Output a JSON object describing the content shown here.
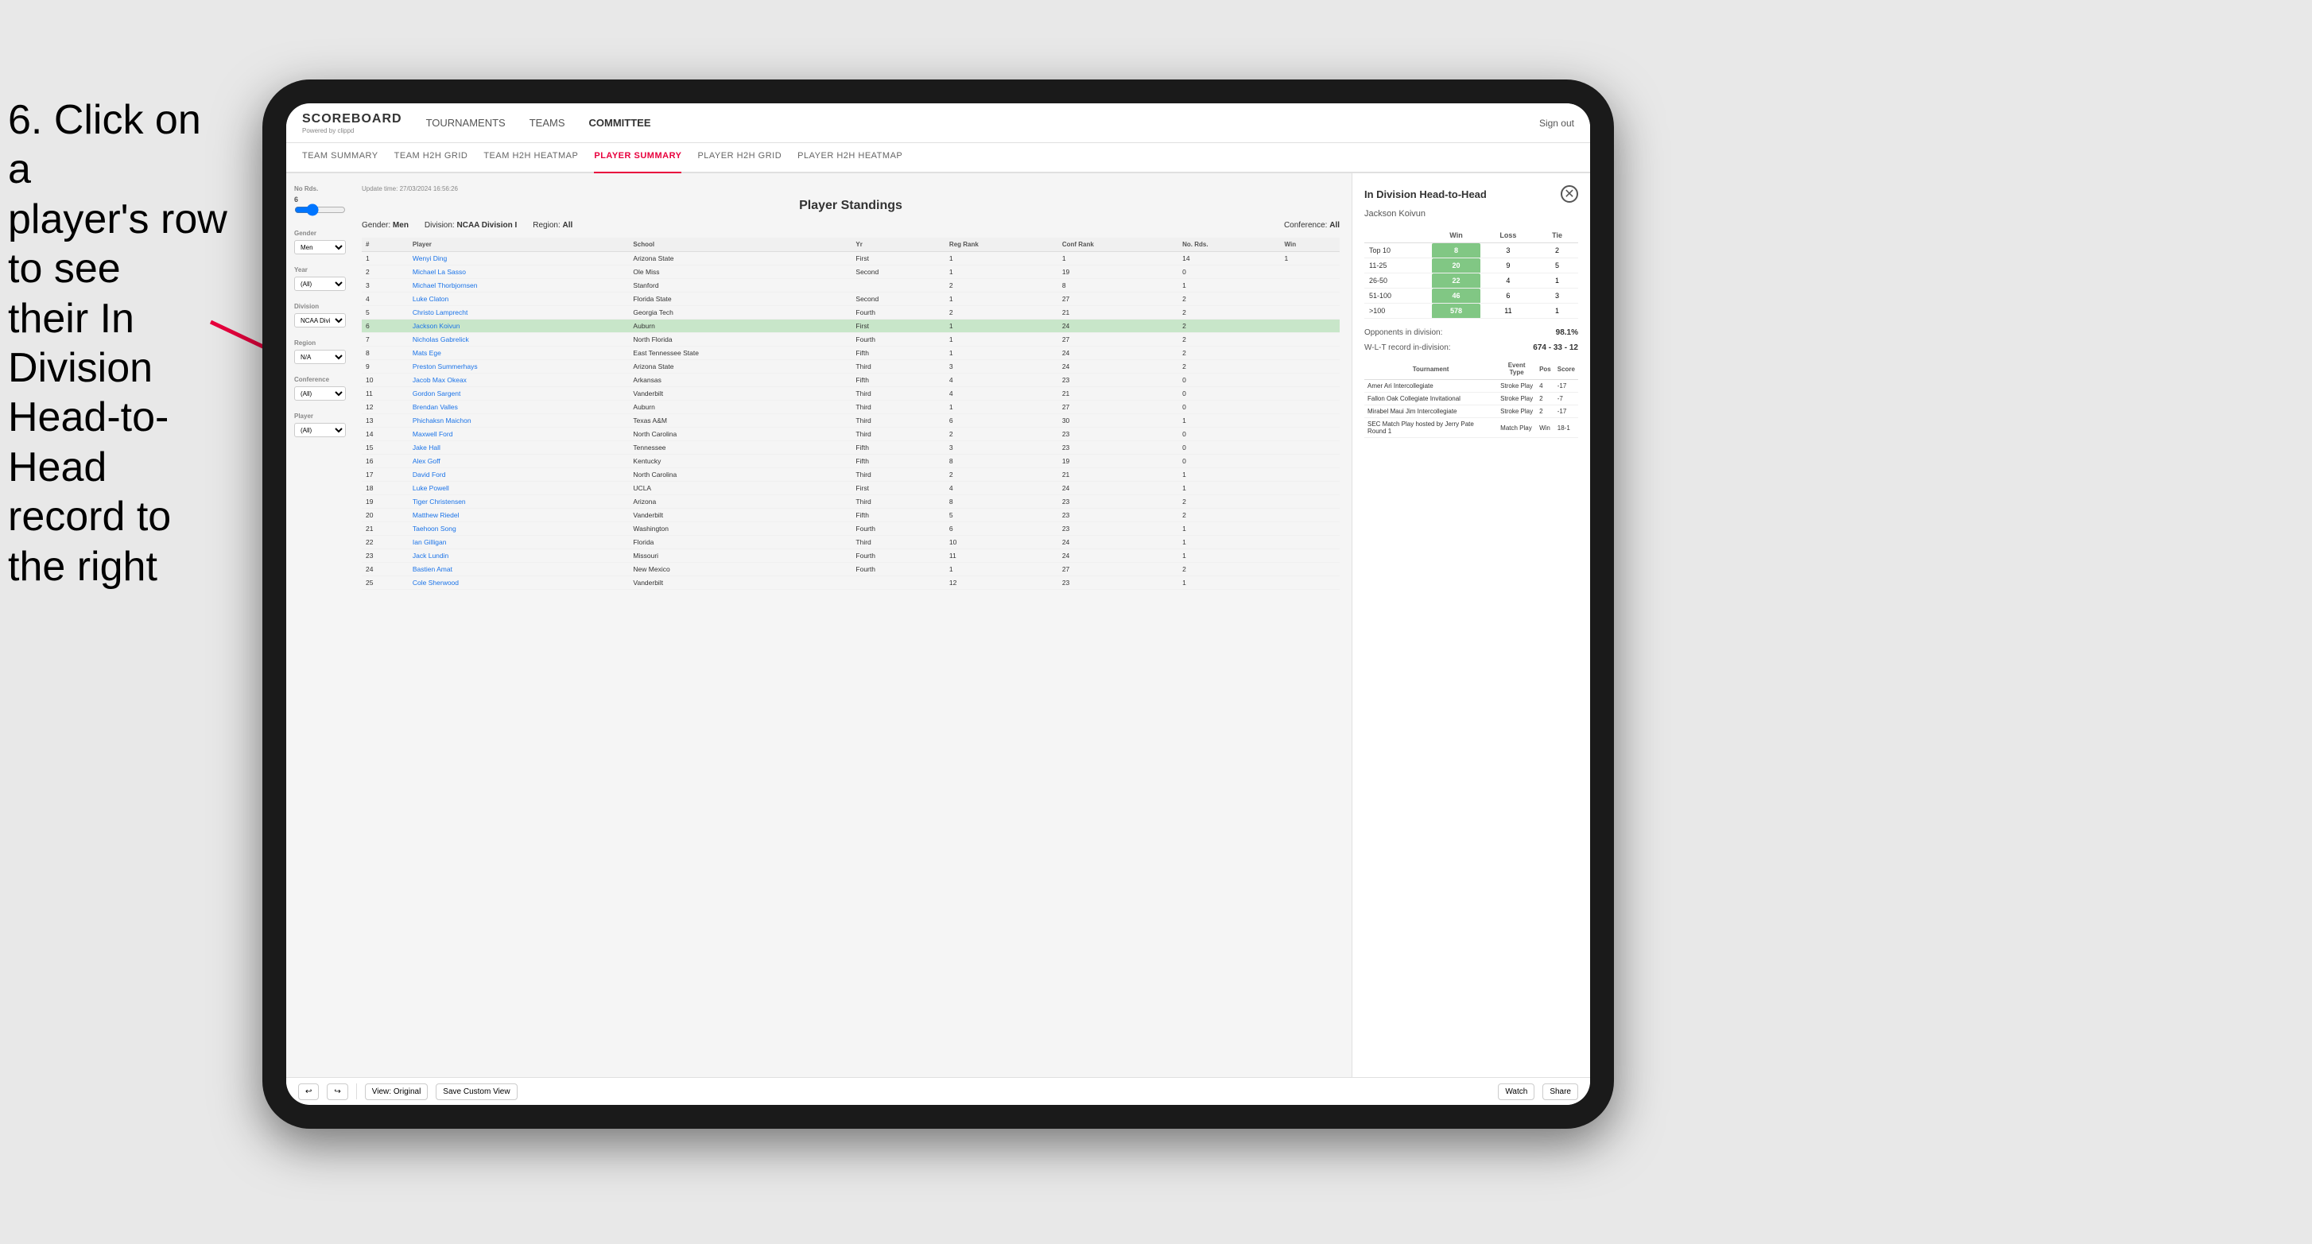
{
  "instruction": {
    "line1": "6. Click on a",
    "line2": "player's row to see",
    "line3": "their In Division",
    "line4": "Head-to-Head",
    "line5": "record to the right"
  },
  "header": {
    "logo": "SCOREBOARD",
    "logo_sub": "Powered by clippd",
    "nav": [
      "TOURNAMENTS",
      "TEAMS",
      "COMMITTEE"
    ],
    "sign_out": "Sign out"
  },
  "sub_nav": [
    "TEAM SUMMARY",
    "TEAM H2H GRID",
    "TEAM H2H HEATMAP",
    "PLAYER SUMMARY",
    "PLAYER H2H GRID",
    "PLAYER H2H HEATMAP"
  ],
  "active_sub_nav": "PLAYER SUMMARY",
  "update_time": "Update time: 27/03/2024 16:56:26",
  "standings": {
    "title": "Player Standings",
    "filters": {
      "gender": "Men",
      "division": "NCAA Division I",
      "region": "All",
      "conference": "All"
    },
    "columns": [
      "#",
      "Player",
      "School",
      "Yr",
      "Reg Rank",
      "Conf Rank",
      "No. Rds.",
      "Win"
    ],
    "rows": [
      {
        "num": "1",
        "player": "Wenyi Ding",
        "school": "Arizona State",
        "yr": "First",
        "reg": "1",
        "conf": "1",
        "rds": "14",
        "win": "1"
      },
      {
        "num": "2",
        "player": "Michael La Sasso",
        "school": "Ole Miss",
        "yr": "Second",
        "reg": "1",
        "conf": "19",
        "rds": "0"
      },
      {
        "num": "3",
        "player": "Michael Thorbjornsen",
        "school": "Stanford",
        "yr": "",
        "reg": "2",
        "conf": "8",
        "rds": "1"
      },
      {
        "num": "4",
        "player": "Luke Claton",
        "school": "Florida State",
        "yr": "Second",
        "reg": "1",
        "conf": "27",
        "rds": "2"
      },
      {
        "num": "5",
        "player": "Christo Lamprecht",
        "school": "Georgia Tech",
        "yr": "Fourth",
        "reg": "2",
        "conf": "21",
        "rds": "2"
      },
      {
        "num": "6",
        "player": "Jackson Koivun",
        "school": "Auburn",
        "yr": "First",
        "reg": "1",
        "conf": "24",
        "rds": "2",
        "highlighted": true
      },
      {
        "num": "7",
        "player": "Nicholas Gabrelick",
        "school": "North Florida",
        "yr": "Fourth",
        "reg": "1",
        "conf": "27",
        "rds": "2"
      },
      {
        "num": "8",
        "player": "Mats Ege",
        "school": "East Tennessee State",
        "yr": "Fifth",
        "reg": "1",
        "conf": "24",
        "rds": "2"
      },
      {
        "num": "9",
        "player": "Preston Summerhays",
        "school": "Arizona State",
        "yr": "Third",
        "reg": "3",
        "conf": "24",
        "rds": "2"
      },
      {
        "num": "10",
        "player": "Jacob Max Okeax",
        "school": "Arkansas",
        "yr": "Fifth",
        "reg": "4",
        "conf": "23",
        "rds": "0"
      },
      {
        "num": "11",
        "player": "Gordon Sargent",
        "school": "Vanderbilt",
        "yr": "Third",
        "reg": "4",
        "conf": "21",
        "rds": "0"
      },
      {
        "num": "12",
        "player": "Brendan Valles",
        "school": "Auburn",
        "yr": "Third",
        "reg": "1",
        "conf": "27",
        "rds": "0"
      },
      {
        "num": "13",
        "player": "Phichaksn Maichon",
        "school": "Texas A&M",
        "yr": "Third",
        "reg": "6",
        "conf": "30",
        "rds": "1"
      },
      {
        "num": "14",
        "player": "Maxwell Ford",
        "school": "North Carolina",
        "yr": "Third",
        "reg": "2",
        "conf": "23",
        "rds": "0"
      },
      {
        "num": "15",
        "player": "Jake Hall",
        "school": "Tennessee",
        "yr": "Fifth",
        "reg": "3",
        "conf": "23",
        "rds": "0"
      },
      {
        "num": "16",
        "player": "Alex Goff",
        "school": "Kentucky",
        "yr": "Fifth",
        "reg": "8",
        "conf": "19",
        "rds": "0"
      },
      {
        "num": "17",
        "player": "David Ford",
        "school": "North Carolina",
        "yr": "Third",
        "reg": "2",
        "conf": "21",
        "rds": "1"
      },
      {
        "num": "18",
        "player": "Luke Powell",
        "school": "UCLA",
        "yr": "First",
        "reg": "4",
        "conf": "24",
        "rds": "1"
      },
      {
        "num": "19",
        "player": "Tiger Christensen",
        "school": "Arizona",
        "yr": "Third",
        "reg": "8",
        "conf": "23",
        "rds": "2"
      },
      {
        "num": "20",
        "player": "Matthew Riedel",
        "school": "Vanderbilt",
        "yr": "Fifth",
        "reg": "5",
        "conf": "23",
        "rds": "2"
      },
      {
        "num": "21",
        "player": "Taehoon Song",
        "school": "Washington",
        "yr": "Fourth",
        "reg": "6",
        "conf": "23",
        "rds": "1"
      },
      {
        "num": "22",
        "player": "Ian Gilligan",
        "school": "Florida",
        "yr": "Third",
        "reg": "10",
        "conf": "24",
        "rds": "1"
      },
      {
        "num": "23",
        "player": "Jack Lundin",
        "school": "Missouri",
        "yr": "Fourth",
        "reg": "11",
        "conf": "24",
        "rds": "1"
      },
      {
        "num": "24",
        "player": "Bastien Amat",
        "school": "New Mexico",
        "yr": "Fourth",
        "reg": "1",
        "conf": "27",
        "rds": "2"
      },
      {
        "num": "25",
        "player": "Cole Sherwood",
        "school": "Vanderbilt",
        "yr": "",
        "reg": "12",
        "conf": "23",
        "rds": "1"
      }
    ]
  },
  "h2h": {
    "title": "In Division Head-to-Head",
    "player": "Jackson Koivun",
    "table": {
      "headers": [
        "",
        "Win",
        "Loss",
        "Tie"
      ],
      "rows": [
        {
          "range": "Top 10",
          "win": "8",
          "loss": "3",
          "tie": "2"
        },
        {
          "range": "11-25",
          "win": "20",
          "loss": "9",
          "tie": "5"
        },
        {
          "range": "26-50",
          "win": "22",
          "loss": "4",
          "tie": "1"
        },
        {
          "range": "51-100",
          "win": "46",
          "loss": "6",
          "tie": "3"
        },
        {
          "range": ">100",
          "win": "578",
          "loss": "11",
          "tie": "1"
        }
      ]
    },
    "opponents_pct": "98.1%",
    "wlt_record": "674 - 33 - 12",
    "opponents_label": "Opponents in division:",
    "wlt_label": "W-L-T record in-division:",
    "tournament_headers": [
      "Tournament",
      "Event Type",
      "Pos",
      "Score"
    ],
    "tournaments": [
      {
        "name": "Amer Ari Intercollegiate",
        "type": "Stroke Play",
        "pos": "4",
        "score": "-17"
      },
      {
        "name": "Fallon Oak Collegiate Invitational",
        "type": "Stroke Play",
        "pos": "2",
        "score": "-7"
      },
      {
        "name": "Mirabel Maui Jim Intercollegiate",
        "type": "Stroke Play",
        "pos": "2",
        "score": "-17"
      },
      {
        "name": "SEC Match Play hosted by Jerry Pate Round 1",
        "type": "Match Play",
        "pos": "Win",
        "score": "18-1"
      }
    ]
  },
  "filters": {
    "no_rds_label": "No Rds.",
    "no_rds_value": "6",
    "gender_label": "Gender",
    "gender_value": "Men",
    "year_label": "Year",
    "year_value": "(All)",
    "division_label": "Division",
    "division_value": "NCAA Division I",
    "region_label": "Region",
    "region_value": "N/A",
    "conference_label": "Conference",
    "conference_value": "(All)",
    "player_label": "Player",
    "player_value": "(All)"
  },
  "toolbar": {
    "view_original": "View: Original",
    "save_custom": "Save Custom View",
    "watch": "Watch",
    "share": "Share"
  }
}
